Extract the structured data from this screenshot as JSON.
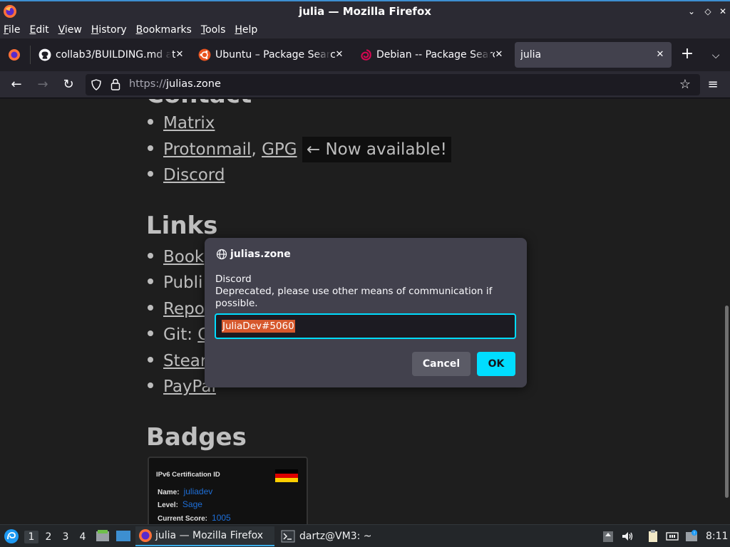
{
  "window": {
    "title": "julia — Mozilla Firefox"
  },
  "menubar": {
    "items": [
      {
        "u": "F",
        "rest": "ile"
      },
      {
        "u": "E",
        "rest": "dit"
      },
      {
        "u": "V",
        "rest": "iew"
      },
      {
        "u": "H",
        "rest": "istory"
      },
      {
        "u": "B",
        "rest": "ookmarks"
      },
      {
        "u": "T",
        "rest": "ools"
      },
      {
        "u": "H",
        "rest": "elp"
      }
    ]
  },
  "tabs": [
    {
      "label": "collab3/BUILDING.md at",
      "icon": "github-icon",
      "active": false
    },
    {
      "label": "Ubuntu – Package Search",
      "icon": "ubuntu-icon",
      "active": false
    },
    {
      "label": "Debian -- Package Search",
      "icon": "debian-icon",
      "active": false
    },
    {
      "label": "julia",
      "icon": "none",
      "active": true
    }
  ],
  "navbar": {
    "url_scheme": "https://",
    "url_host": "julias.zone"
  },
  "page": {
    "contact_heading": "Contact",
    "contact_items": [
      {
        "link": "Matrix"
      },
      {
        "link": "Protonmail",
        "sep": ", ",
        "link2": "GPG",
        "note": "← Now available!"
      },
      {
        "link": "Discord"
      }
    ],
    "links_heading": "Links",
    "links_items": [
      {
        "text": "Book",
        "underlined": true
      },
      {
        "text": "Publi",
        "underlined": false
      },
      {
        "text": "Repo",
        "underlined": true
      },
      {
        "text": "Git: ",
        "underlined": false,
        "link": "C"
      },
      {
        "text": "Stear",
        "underlined": true
      },
      {
        "text": "PayPal",
        "underlined": true
      }
    ],
    "badges_heading": "Badges",
    "badge": {
      "title": "IPv6 Certification ID",
      "name_label": "Name:",
      "name_value": "juliadev",
      "level_label": "Level:",
      "level_value": "Sage",
      "score_label": "Current Score:",
      "score_value": "1005"
    }
  },
  "dialog": {
    "origin": "julias.zone",
    "message_line1": "Discord",
    "message_line2": "Deprecated, please use other means of communication if possible.",
    "input_value": "JuliaDev#5060",
    "cancel_label": "Cancel",
    "ok_label": "OK"
  },
  "taskbar": {
    "workspaces": [
      "1",
      "2",
      "3",
      "4"
    ],
    "tasks": [
      {
        "label": "julia — Mozilla Firefox",
        "active": true
      },
      {
        "label": "dartz@VM3: ~",
        "active": false
      }
    ],
    "clock": "8:11"
  },
  "colors": {
    "accent": "#00ddff",
    "selection": "#d6582c",
    "page_bg": "#1e1e1e"
  }
}
